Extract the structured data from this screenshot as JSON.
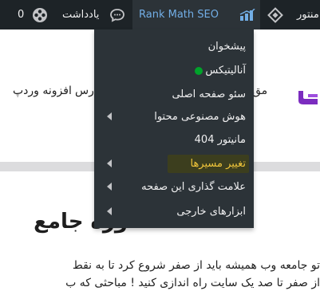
{
  "adminbar": {
    "site_label_partial": "منتور",
    "rankmath_label": "Rank Math SEO",
    "notes_label": "یادداشت",
    "count": "0"
  },
  "submenu": {
    "items": [
      {
        "label": "پیشخوان",
        "has_arrow": false
      },
      {
        "label": "آنالیتیکس",
        "has_arrow": false,
        "status_dot": "#00a32a"
      },
      {
        "label": "سئو صفحه اصلی",
        "has_arrow": false
      },
      {
        "label": "هوش مصنوعی محتوا",
        "has_arrow": true
      },
      {
        "label": "مانیتور 404",
        "has_arrow": false
      },
      {
        "label": "تغییر مسیرها",
        "has_arrow": true,
        "highlighted": true
      },
      {
        "label": "علامت گذاری این صفحه",
        "has_arrow": true
      },
      {
        "label": "ابزارهای خارجی",
        "has_arrow": true
      }
    ]
  },
  "page": {
    "nav_left": "افزونه وردپ",
    "nav_mid": "رس",
    "nav_right": "مق",
    "title_fragment": "وره جامع",
    "body_line1": "تو جامعه وب همیشه باید از صفر شروع کرد تا به نقط",
    "body_line2": "از صفر تا صد یک سایت راه اندازی کنید ! مباحثی که ب"
  },
  "colors": {
    "adminbar_bg": "#1d2327",
    "submenu_bg": "#2c3338",
    "highlight_text": "#f0c53a",
    "status_green": "#00a32a",
    "link_blue": "#72aee6"
  }
}
